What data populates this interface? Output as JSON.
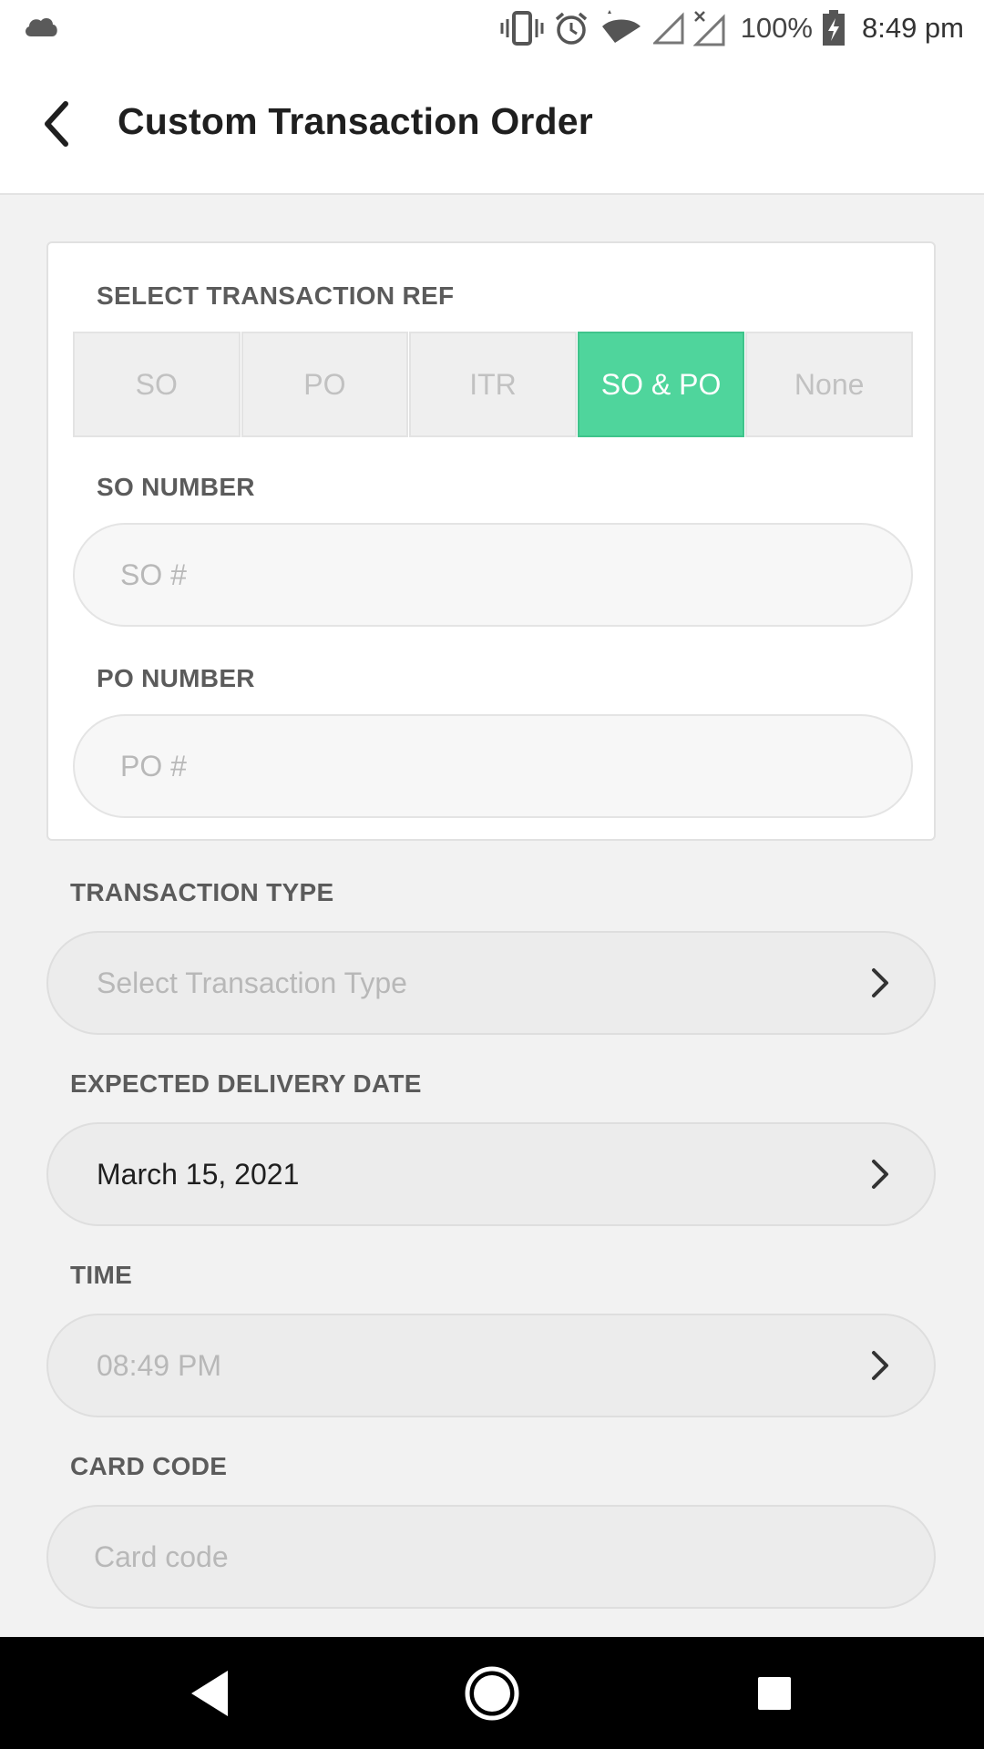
{
  "status_bar": {
    "battery_percent": "100%",
    "time": "8:49 pm",
    "icons": [
      "cloud-icon",
      "vibrate-icon",
      "alarm-icon",
      "wifi-icon",
      "signal-icon",
      "no-signal-icon",
      "battery-charging-icon"
    ]
  },
  "app_bar": {
    "title": "Custom Transaction Order",
    "back_icon": "arrow-back-icon"
  },
  "transaction_ref": {
    "label": "SELECT TRANSACTION REF",
    "options": [
      "SO",
      "PO",
      "ITR",
      "SO & PO",
      "None"
    ],
    "selected": "SO & PO",
    "accent_color": "#4fd59c"
  },
  "so_number": {
    "label": "SO NUMBER",
    "placeholder": "SO #",
    "value": ""
  },
  "po_number": {
    "label": "PO NUMBER",
    "placeholder": "PO #",
    "value": ""
  },
  "transaction_type": {
    "label": "TRANSACTION TYPE",
    "placeholder": "Select Transaction Type",
    "icon": "chevron-right-icon"
  },
  "delivery_date": {
    "label": "EXPECTED DELIVERY DATE",
    "value": "March 15, 2021",
    "icon": "chevron-right-icon"
  },
  "time": {
    "label": "TIME",
    "placeholder": "08:49 PM",
    "icon": "chevron-right-icon"
  },
  "card_code": {
    "label": "CARD CODE",
    "placeholder": "Card code",
    "value": ""
  },
  "nav_bar": {
    "icons": [
      "nav-back-icon",
      "nav-home-icon",
      "nav-recents-icon"
    ]
  }
}
